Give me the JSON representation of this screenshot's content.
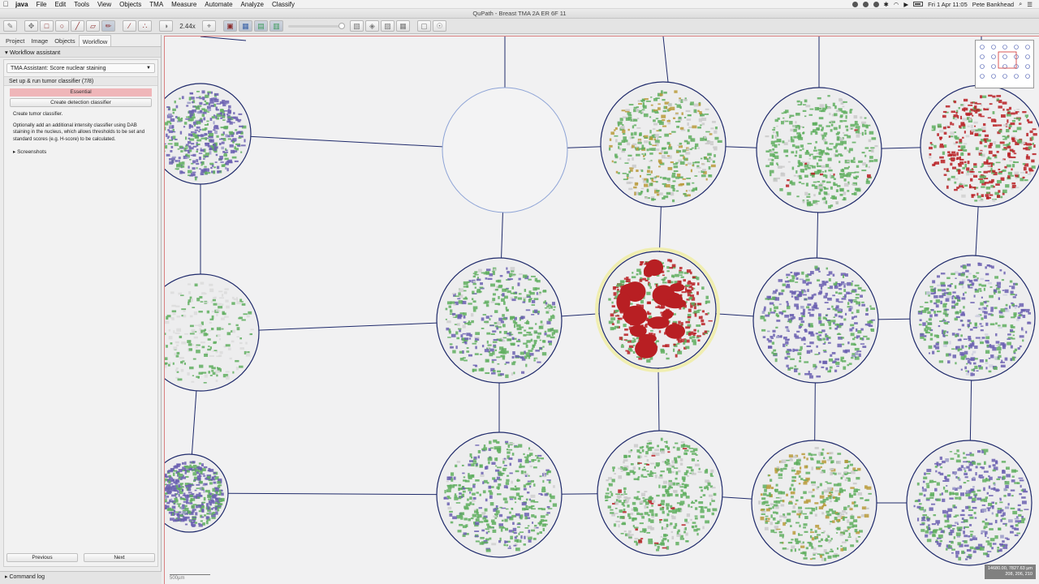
{
  "menubar": {
    "apple": "",
    "items": [
      "java",
      "File",
      "Edit",
      "Tools",
      "View",
      "Objects",
      "TMA",
      "Measure",
      "Automate",
      "Analyze",
      "Classify"
    ],
    "clock": "Fri 1 Apr  11:05",
    "user": "Pete Bankhead"
  },
  "window": {
    "title": "QuPath - Breast TMA 2A ER 6F 11"
  },
  "toolbar": {
    "zoom": "2.44x"
  },
  "left_tabs": [
    "Project",
    "Image",
    "Objects",
    "Workflow"
  ],
  "workflow": {
    "header": "Workflow assistant",
    "selected_workflow": "TMA Assistant: Score nuclear staining",
    "step": "Set up & run tumor classifier  (7/8)",
    "essential": "Essential",
    "create_button": "Create detection classifier",
    "desc1": "Create tumor classifier.",
    "desc2": "Optionally add an additional intensity classifier using DAB staining in the nucleus, which allows thresholds to be set and standard scores (e.g. H-score) to be calculated.",
    "screenshots": "Screenshots",
    "previous": "Previous",
    "next": "Next"
  },
  "command_log": "Command log",
  "viewer": {
    "scalebar": "500µm",
    "coords_line1": "14680.00, 7827.63 µm",
    "coords_line2": "208, 206, 210"
  },
  "colors": {
    "grid_line": "#1f2a6b",
    "tumor_red": "#b81f23",
    "stroma_green": "#5fae5f",
    "nuclei_purple": "#6a5fb0",
    "selected_core": "#f0eeb0",
    "missing_core": "#8da3d6"
  }
}
